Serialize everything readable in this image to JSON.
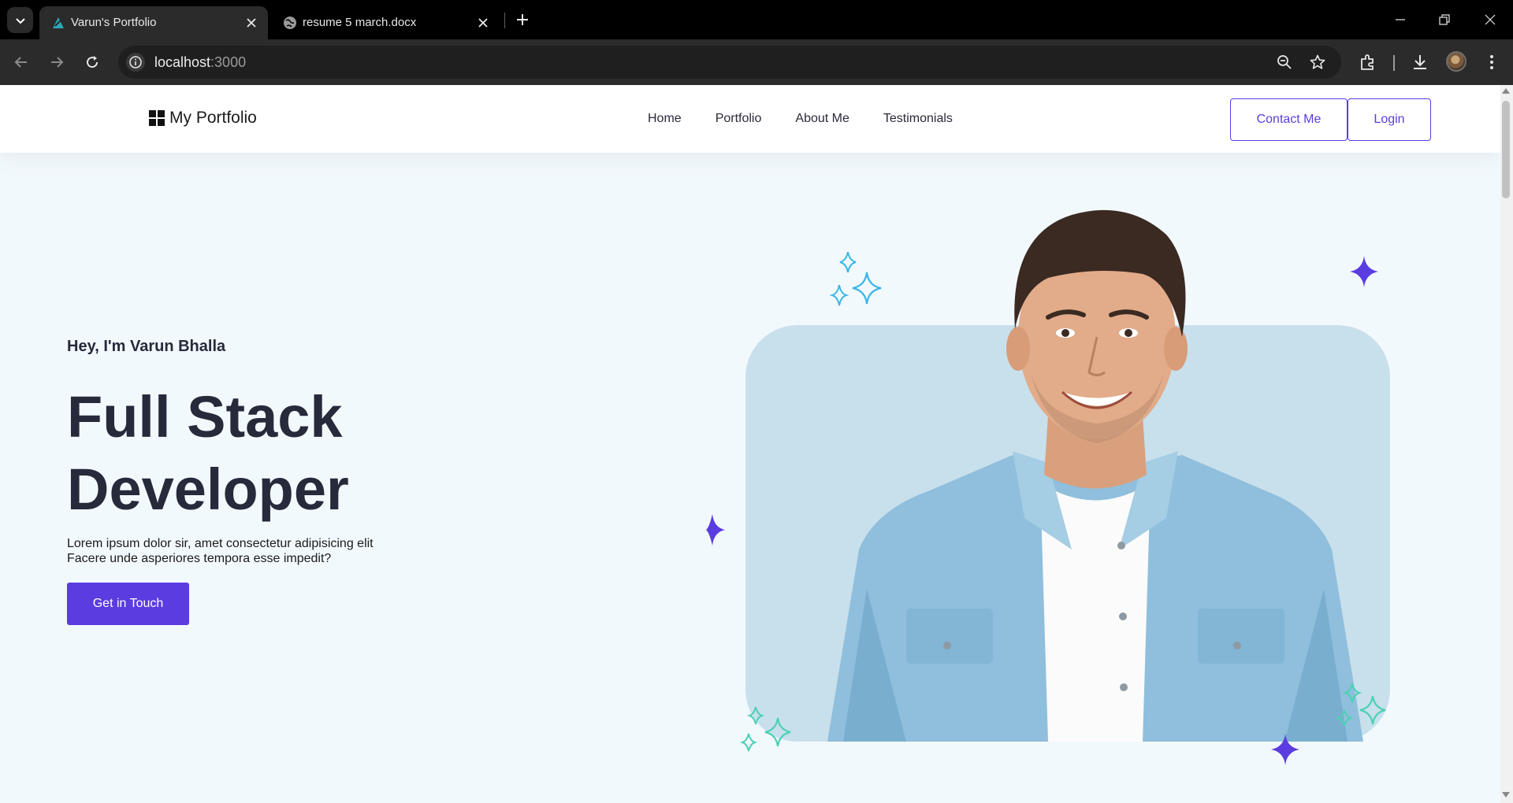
{
  "browser": {
    "tabs": [
      {
        "title": "Varun's Portfolio",
        "active": true
      },
      {
        "title": "resume 5 march.docx",
        "active": false
      }
    ],
    "url_host": "localhost",
    "url_port": ":3000"
  },
  "site": {
    "logo_text": "My Portfolio",
    "nav": [
      "Home",
      "Portfolio",
      "About Me",
      "Testimonials"
    ],
    "contact_label": "Contact Me",
    "login_label": "Login"
  },
  "hero": {
    "greeting": "Hey, I'm Varun Bhalla",
    "title_line1": "Full Stack",
    "title_line2": "Developer",
    "desc_line1": "Lorem ipsum dolor sir, amet consectetur adipisicing elit",
    "desc_line2": "Facere unde asperiores tempora esse impedit?",
    "cta_label": "Get in Touch"
  },
  "colors": {
    "accent": "#5b3ce0",
    "page_bg": "#f2f9fd",
    "card_bg": "#c8e0ec",
    "sparkle_blue": "#3bb7e6",
    "sparkle_teal": "#4dd0b4"
  },
  "icons": [
    "tab-list-icon",
    "portfolio-favicon",
    "globe-icon",
    "close-icon",
    "plus-icon",
    "minimize-icon",
    "restore-icon",
    "back-icon",
    "forward-icon",
    "reload-icon",
    "info-icon",
    "zoom-icon",
    "star-icon",
    "extensions-icon",
    "download-icon",
    "menu-icon"
  ]
}
